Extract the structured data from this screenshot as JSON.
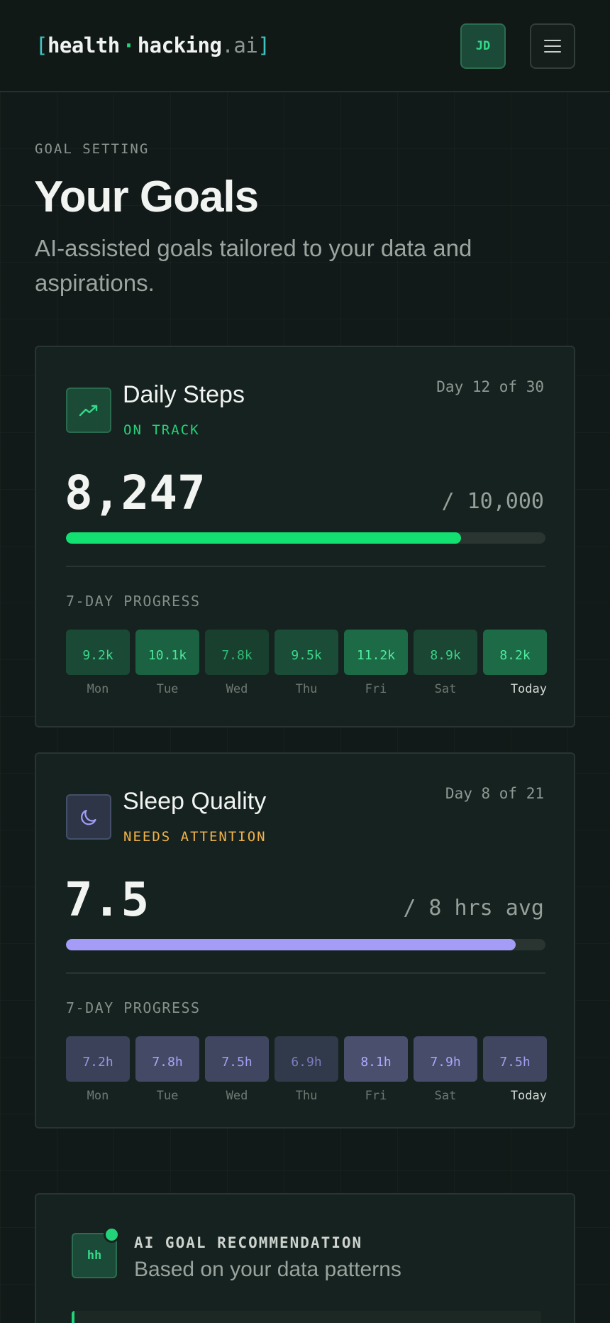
{
  "header": {
    "logo": {
      "bracket_open": "[",
      "word1": "health",
      "dot": "·",
      "word2": "hacking",
      "suffix": ".ai",
      "bracket_close": "]"
    },
    "avatar_initials": "JD",
    "menu_icon": "hamburger-icon"
  },
  "intro": {
    "eyebrow": "GOAL SETTING",
    "title": "Your Goals",
    "subtitle": "AI-assisted goals tailored to your data and aspirations."
  },
  "goals": [
    {
      "title": "Daily Steps",
      "icon": "trending-up-icon",
      "status": "ON TRACK",
      "day_of": "Day 12 of 30",
      "value": "8,247",
      "target": "/ 10,000",
      "progress": 0.8247,
      "section_label": "7-DAY PROGRESS",
      "accent": "#12e070",
      "days": [
        {
          "value": "9.2k",
          "label": "Mon"
        },
        {
          "value": "10.1k",
          "label": "Tue"
        },
        {
          "value": "7.8k",
          "label": "Wed"
        },
        {
          "value": "9.5k",
          "label": "Thu"
        },
        {
          "value": "11.2k",
          "label": "Fri"
        },
        {
          "value": "8.9k",
          "label": "Sat"
        },
        {
          "value": "8.2k",
          "label": "Today"
        }
      ]
    },
    {
      "title": "Sleep Quality",
      "icon": "moon-icon",
      "status": "NEEDS ATTENTION",
      "day_of": "Day 8 of 21",
      "value": "7.5",
      "target": "/ 8 hrs avg",
      "progress": 0.9375,
      "section_label": "7-DAY PROGRESS",
      "accent": "#a59cf8",
      "days": [
        {
          "value": "7.2h",
          "label": "Mon"
        },
        {
          "value": "7.8h",
          "label": "Tue"
        },
        {
          "value": "7.5h",
          "label": "Wed"
        },
        {
          "value": "6.9h",
          "label": "Thu"
        },
        {
          "value": "8.1h",
          "label": "Fri"
        },
        {
          "value": "7.9h",
          "label": "Sat"
        },
        {
          "value": "7.5h",
          "label": "Today"
        }
      ]
    }
  ],
  "recommendation": {
    "avatar_initials": "hh",
    "title": "AI GOAL RECOMMENDATION",
    "subtitle": "Based on your data patterns"
  },
  "colors": {
    "on_track": "#22d37a",
    "needs_attention": "#f0b24a",
    "steps_accent": "#12e070",
    "sleep_accent": "#a59cf8"
  }
}
